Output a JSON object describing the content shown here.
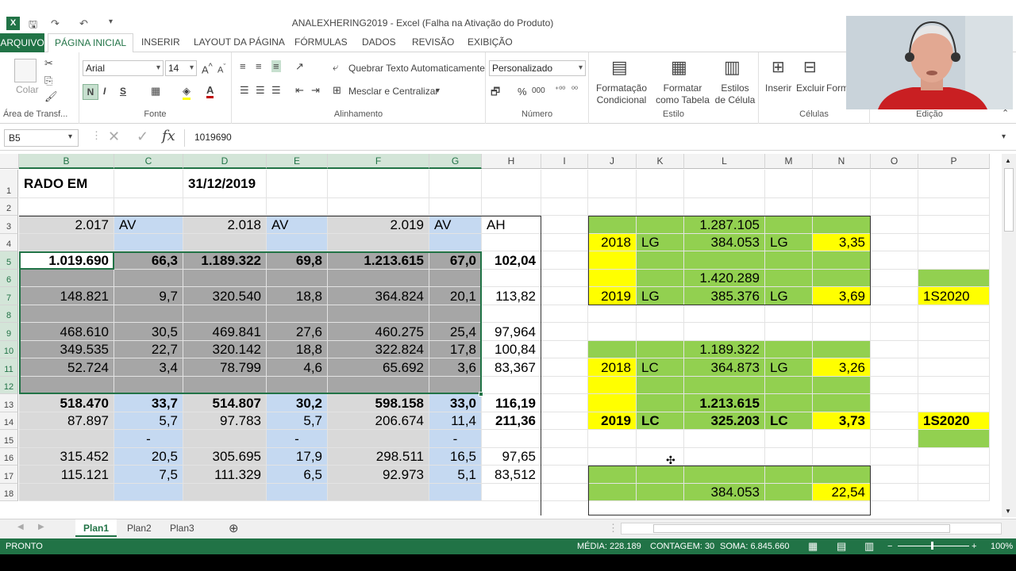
{
  "window": {
    "title": "ANALEXHERING2019 - Excel (Falha na Ativação do Produto)"
  },
  "tabs": [
    "ARQUIVO",
    "PÁGINA INICIAL",
    "INSERIR",
    "LAYOUT DA PÁGINA",
    "FÓRMULAS",
    "DADOS",
    "REVISÃO",
    "EXIBIÇÃO"
  ],
  "ribbon": {
    "clipboard": {
      "paste": "Colar",
      "label": "Área de Transf..."
    },
    "font": {
      "name": "Arial",
      "size": "14",
      "bold": "N",
      "italic": "I",
      "underline": "S",
      "label": "Fonte"
    },
    "alignment": {
      "wrap": "Quebrar Texto Automaticamente",
      "merge": "Mesclar e Centralizar",
      "label": "Alinhamento"
    },
    "number": {
      "format": "Personalizado",
      "percent": "%",
      "thousands": "000",
      "label": "Número"
    },
    "styles": {
      "conditional": "Formatação Condicional",
      "table": "Formatar como Tabela",
      "cell": "Estilos de Célula",
      "label": "Estilo"
    },
    "cells": {
      "insert": "Inserir",
      "delete": "Excluir",
      "format": "Form",
      "label": "Células"
    },
    "editing": {
      "label": "Edição"
    }
  },
  "formula_bar": {
    "name_box": "B5",
    "value": "1019690"
  },
  "columns": [
    "B",
    "C",
    "D",
    "E",
    "F",
    "G",
    "H",
    "I",
    "J",
    "K",
    "L",
    "M",
    "N",
    "O",
    "P"
  ],
  "rows": [
    "1",
    "2",
    "3",
    "4",
    "5",
    "6",
    "7",
    "8",
    "9",
    "10",
    "11",
    "12",
    "13",
    "14",
    "15",
    "16",
    "17",
    "18"
  ],
  "cells": {
    "r1": {
      "b": "RADO EM",
      "d": "31/12/2019"
    },
    "r3": {
      "b": "2.017",
      "c": "AV",
      "d": "2.018",
      "e": "AV",
      "f": "2.019",
      "g": "AV",
      "h": "AH",
      "l": "1.287.105"
    },
    "r4": {
      "j": "2018",
      "k": "LG",
      "l": "384.053",
      "m": "LG",
      "n": "3,35"
    },
    "r5": {
      "b": "1.019.690",
      "c": "66,3",
      "d": "1.189.322",
      "e": "69,8",
      "f": "1.213.615",
      "g": "67,0",
      "h": "102,04"
    },
    "r6": {
      "l": "1.420.289"
    },
    "r7": {
      "b": "148.821",
      "c": "9,7",
      "d": "320.540",
      "e": "18,8",
      "f": "364.824",
      "g": "20,1",
      "h": "113,82",
      "j": "2019",
      "k": "LG",
      "l": "385.376",
      "m": "LG",
      "n": "3,69",
      "p": "1S2020"
    },
    "r9": {
      "b": "468.610",
      "c": "30,5",
      "d": "469.841",
      "e": "27,6",
      "f": "460.275",
      "g": "25,4",
      "h": "97,964"
    },
    "r10": {
      "b": "349.535",
      "c": "22,7",
      "d": "320.142",
      "e": "18,8",
      "f": "322.824",
      "g": "17,8",
      "h": "100,84",
      "l": "1.189.322"
    },
    "r11": {
      "b": "52.724",
      "c": "3,4",
      "d": "78.799",
      "e": "4,6",
      "f": "65.692",
      "g": "3,6",
      "h": "83,367",
      "j": "2018",
      "k": "LC",
      "l": "364.873",
      "m": "LG",
      "n": "3,26"
    },
    "r13": {
      "b": "518.470",
      "c": "33,7",
      "d": "514.807",
      "e": "30,2",
      "f": "598.158",
      "g": "33,0",
      "h": "116,19",
      "l": "1.213.615"
    },
    "r14": {
      "b": "87.897",
      "c": "5,7",
      "d": "97.783",
      "e": "5,7",
      "f": "206.674",
      "g": "11,4",
      "h": "211,36",
      "j": "2019",
      "k": "LC",
      "l": "325.203",
      "m": "LC",
      "n": "3,73",
      "p": "1S2020"
    },
    "r15": {
      "c": "-",
      "e": "-",
      "g": "-"
    },
    "r16": {
      "b": "315.452",
      "c": "20,5",
      "d": "305.695",
      "e": "17,9",
      "f": "298.511",
      "g": "16,5",
      "h": "97,65"
    },
    "r17": {
      "b": "115.121",
      "c": "7,5",
      "d": "111.329",
      "e": "6,5",
      "f": "92.973",
      "g": "5,1",
      "h": "83,512"
    },
    "r18": {
      "l": "384.053",
      "n": "22,54"
    }
  },
  "sheets": [
    "Plan1",
    "Plan2",
    "Plan3"
  ],
  "status": {
    "ready": "PRONTO",
    "average": "MÉDIA: 228.189",
    "count": "CONTAGEM: 30",
    "sum": "SOMA: 6.845.660",
    "zoom": "100%"
  },
  "colors": {
    "excel_green": "#217346",
    "cell_green": "#92d050",
    "cell_yellow": "#ffff00",
    "cell_blue": "#c5d9f1",
    "cell_grey": "#d9d9d9",
    "selection": "#a6a6a6"
  }
}
